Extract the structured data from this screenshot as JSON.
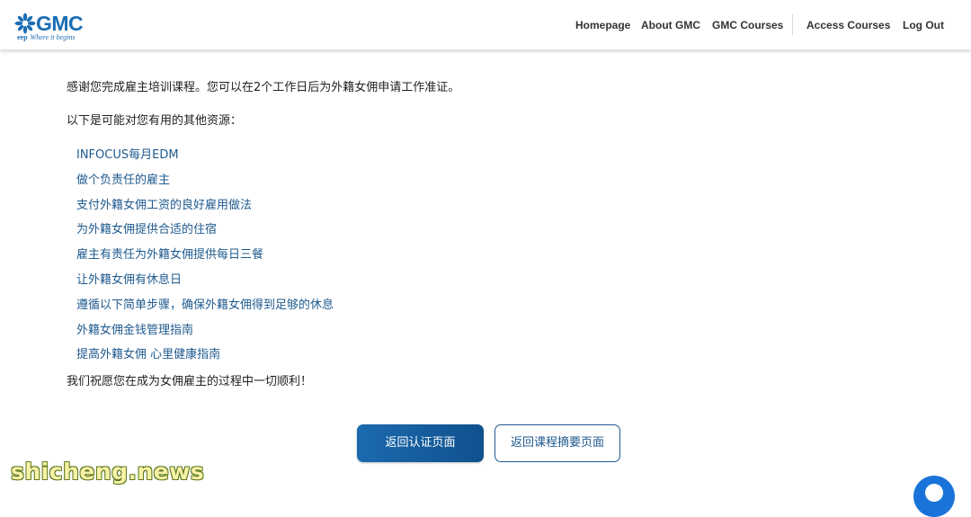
{
  "brand": {
    "name": "GMC",
    "tagline_prefix": "eep",
    "tagline": "Where it begins"
  },
  "nav": {
    "homepage": "Homepage",
    "about": "About GMC",
    "courses": "GMC Courses",
    "access": "Access Courses",
    "logout": "Log Out"
  },
  "content": {
    "thanks": "感谢您完成雇主培训课程。您可以在2个工作日后为外籍女佣申请工作准证。",
    "intro": "以下是可能对您有用的其他资源：",
    "links": [
      "INFOCUS每月EDM",
      "做个负责任的雇主",
      "支付外籍女佣工资的良好雇用做法",
      "为外籍女佣提供合适的住宿",
      "雇主有责任为外籍女佣提供每日三餐",
      "让外籍女佣有休息日",
      "遵循以下简单步骤，确保外籍女佣得到足够的休息",
      "外籍女佣金钱管理指南",
      "提高外籍女佣 心里健康指南"
    ],
    "closing": "我们祝愿您在成为女佣雇主的过程中一切顺利！"
  },
  "buttons": {
    "primary": "返回认证页面",
    "secondary": "返回课程摘要页面"
  },
  "watermark": "shicheng.news",
  "colors": {
    "brand_blue": "#1b6db3",
    "link": "#1f5a8e",
    "button_primary": "#1c6aae",
    "chat": "#1a73d9"
  },
  "icons": {
    "logo": "gmc-flower-logo",
    "chat": "chat-bubble-icon"
  }
}
